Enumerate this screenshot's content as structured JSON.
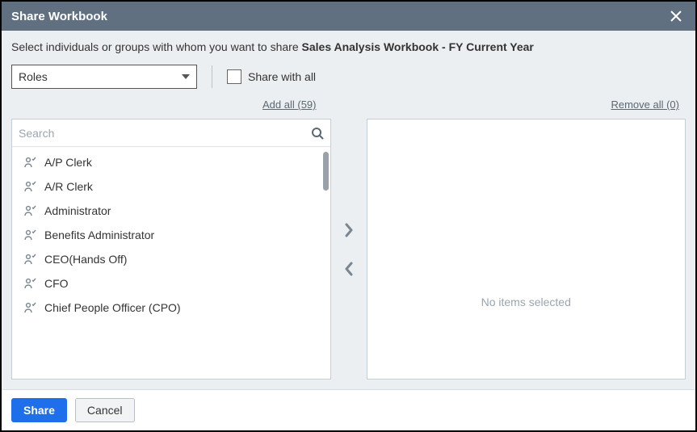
{
  "titlebar": {
    "title": "Share Workbook"
  },
  "instruction": {
    "prefix": "Select individuals or groups with whom you want to share ",
    "workbook_name": "Sales Analysis Workbook - FY Current Year"
  },
  "controls": {
    "dropdown_value": "Roles",
    "share_all_label": "Share with all"
  },
  "links": {
    "add_all": "Add all (59)",
    "remove_all": "Remove all (0)"
  },
  "search": {
    "placeholder": "Search"
  },
  "available_roles": [
    "A/P Clerk",
    "A/R Clerk",
    "Administrator",
    "Benefits Administrator",
    "CEO(Hands Off)",
    "CFO",
    "Chief People Officer (CPO)"
  ],
  "selected_panel": {
    "empty_message": "No items selected"
  },
  "footer": {
    "share": "Share",
    "cancel": "Cancel"
  }
}
